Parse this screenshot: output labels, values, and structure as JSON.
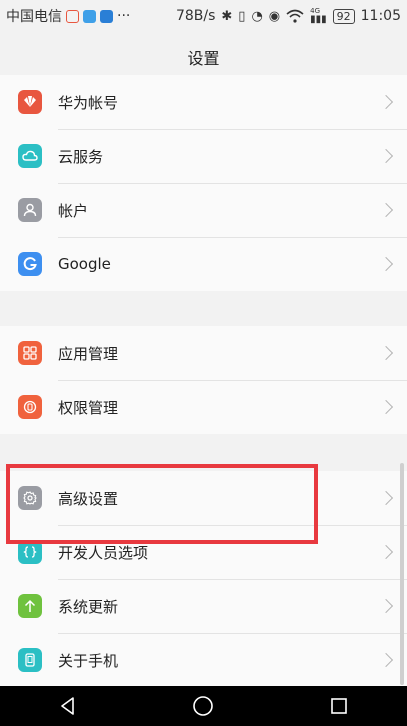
{
  "status_bar": {
    "carrier": "中国电信",
    "more": "···",
    "speed": "78B/s",
    "network_label": "4G",
    "battery": "92",
    "time": "11:05"
  },
  "header": {
    "title": "设置"
  },
  "groups": [
    {
      "items": [
        {
          "label": "华为帐号",
          "icon": "huawei-logo-icon",
          "color": "#e8563f"
        },
        {
          "label": "云服务",
          "icon": "cloud-icon",
          "color": "#2bbfc4"
        },
        {
          "label": "帐户",
          "icon": "person-icon",
          "color": "#9a9ca3"
        },
        {
          "label": "Google",
          "icon": "google-g-icon",
          "color": "#3d8ff0"
        }
      ]
    },
    {
      "items": [
        {
          "label": "应用管理",
          "icon": "apps-grid-icon",
          "color": "#f0623d"
        },
        {
          "label": "权限管理",
          "icon": "permission-icon",
          "color": "#f0623d"
        }
      ]
    },
    {
      "items": [
        {
          "label": "高级设置",
          "icon": "gear-icon",
          "color": "#9a9ca3"
        },
        {
          "label": "开发人员选项",
          "icon": "code-braces-icon",
          "color": "#2bbfc4"
        },
        {
          "label": "系统更新",
          "icon": "arrow-up-icon",
          "color": "#6fc23e"
        },
        {
          "label": "关于手机",
          "icon": "phone-icon",
          "color": "#2bbfc4"
        }
      ]
    }
  ],
  "highlight_color": "#e8393f"
}
